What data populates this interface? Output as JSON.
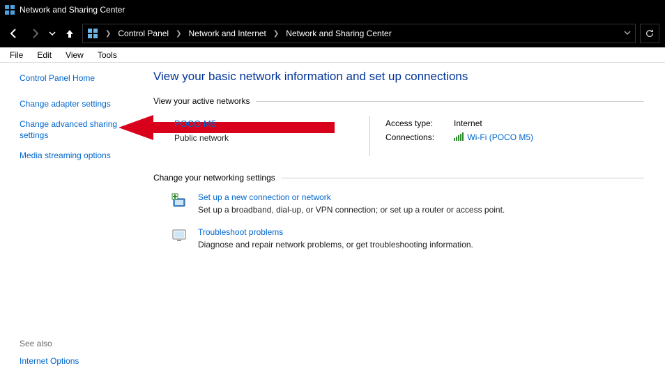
{
  "titlebar": {
    "title": "Network and Sharing Center"
  },
  "breadcrumb": {
    "items": [
      "Control Panel",
      "Network and Internet",
      "Network and Sharing Center"
    ]
  },
  "menubar": {
    "items": [
      "File",
      "Edit",
      "View",
      "Tools"
    ]
  },
  "sidebar": {
    "home": "Control Panel Home",
    "links": [
      "Change adapter settings",
      "Change advanced sharing settings",
      "Media streaming options"
    ],
    "see_also_label": "See also",
    "see_also_links": [
      "Internet Options"
    ]
  },
  "main": {
    "heading": "View your basic network information and set up connections",
    "active_section": "View your active networks",
    "network": {
      "name": "POCO M5",
      "type": "Public network",
      "access_label": "Access type:",
      "access_value": "Internet",
      "conn_label": "Connections:",
      "conn_value": "Wi-Fi (POCO M5)"
    },
    "change_section": "Change your networking settings",
    "actions": [
      {
        "title": "Set up a new connection or network",
        "desc": "Set up a broadband, dial-up, or VPN connection; or set up a router or access point."
      },
      {
        "title": "Troubleshoot problems",
        "desc": "Diagnose and repair network problems, or get troubleshooting information."
      }
    ]
  }
}
